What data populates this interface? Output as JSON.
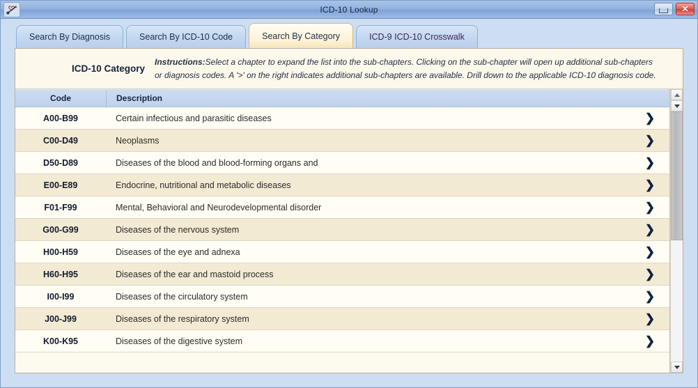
{
  "window": {
    "title": "ICD-10 Lookup",
    "icon": "heart-stethoscope-icon",
    "minimize_label": "",
    "close_label": "✕"
  },
  "tabs": [
    {
      "label": "Search By Diagnosis",
      "selected": false
    },
    {
      "label": "Search By ICD-10 Code",
      "selected": false
    },
    {
      "label": "Search By Category",
      "selected": true
    },
    {
      "label": "ICD-9 ICD-10 Crosswalk",
      "selected": false
    }
  ],
  "instructions": {
    "category_label": "ICD-10 Category",
    "heading": "Instructions:",
    "line1": "Select a chapter to expand the list into the sub-chapters. Clicking on the sub-chapter will open up additional sub-chapters",
    "line2": "or diagnosis codes. A '>' on the right indicates additional sub-chapters are available. Drill down to the applicable ICD-10 diagnosis code."
  },
  "table": {
    "columns": [
      "Code",
      "Description"
    ],
    "arrow_glyph": "❯",
    "rows": [
      {
        "code": "A00-B99",
        "description": "Certain infectious and parasitic diseases"
      },
      {
        "code": "C00-D49",
        "description": "Neoplasms"
      },
      {
        "code": "D50-D89",
        "description": "Diseases of the blood and blood-forming organs and"
      },
      {
        "code": "E00-E89",
        "description": "Endocrine, nutritional and metabolic diseases"
      },
      {
        "code": "F01-F99",
        "description": "Mental, Behavioral and Neurodevelopmental disorder"
      },
      {
        "code": "G00-G99",
        "description": "Diseases of the nervous system"
      },
      {
        "code": "H00-H59",
        "description": "Diseases of the eye and adnexa"
      },
      {
        "code": "H60-H95",
        "description": "Diseases of the ear and mastoid process"
      },
      {
        "code": "I00-I99",
        "description": "Diseases of the circulatory system"
      },
      {
        "code": "J00-J99",
        "description": "Diseases of the respiratory system"
      },
      {
        "code": "K00-K95",
        "description": "Diseases of the digestive system"
      }
    ]
  },
  "colors": {
    "chrome": "#cddef2",
    "titlebar": "#93b3e0",
    "selected_tab": "#fdf2d6",
    "row_light": "#fffdf4",
    "row_alt": "#f3ead3",
    "header": "#c5d7ee",
    "close_button": "#cf4139"
  }
}
